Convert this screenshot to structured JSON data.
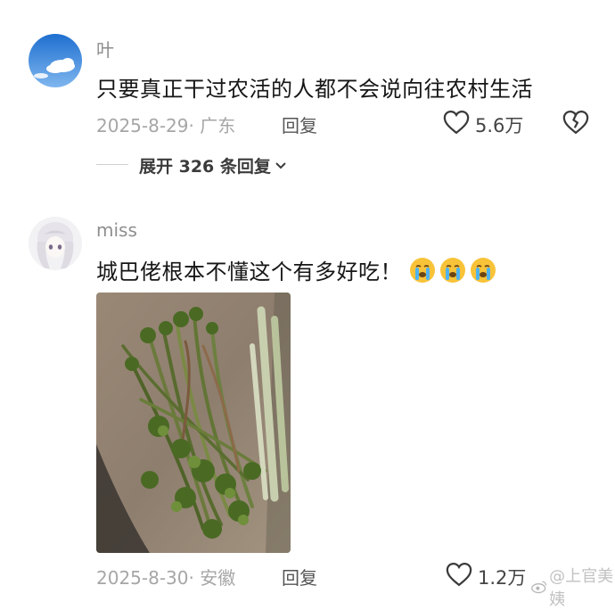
{
  "comments": [
    {
      "username": "叶",
      "text": "只要真正干过农活的人都不会说向往农村生活",
      "date_location": "2025-8-29· 广东",
      "reply_label": "回复",
      "likes": "5.6万",
      "expand_label": "展开 326 条回复"
    },
    {
      "username": "miss",
      "text": "城巴佬根本不懂这个有多好吃！",
      "emoji": [
        "crying-face",
        "crying-face",
        "crying-face"
      ],
      "date_location": "2025-8-30· 安徽",
      "reply_label": "回复",
      "likes": "1.2万"
    }
  ],
  "watermark": "@上官美姨",
  "colors": {
    "text_primary": "#161616",
    "text_meta": "#a6a6a6",
    "username": "#8e8e8e"
  }
}
